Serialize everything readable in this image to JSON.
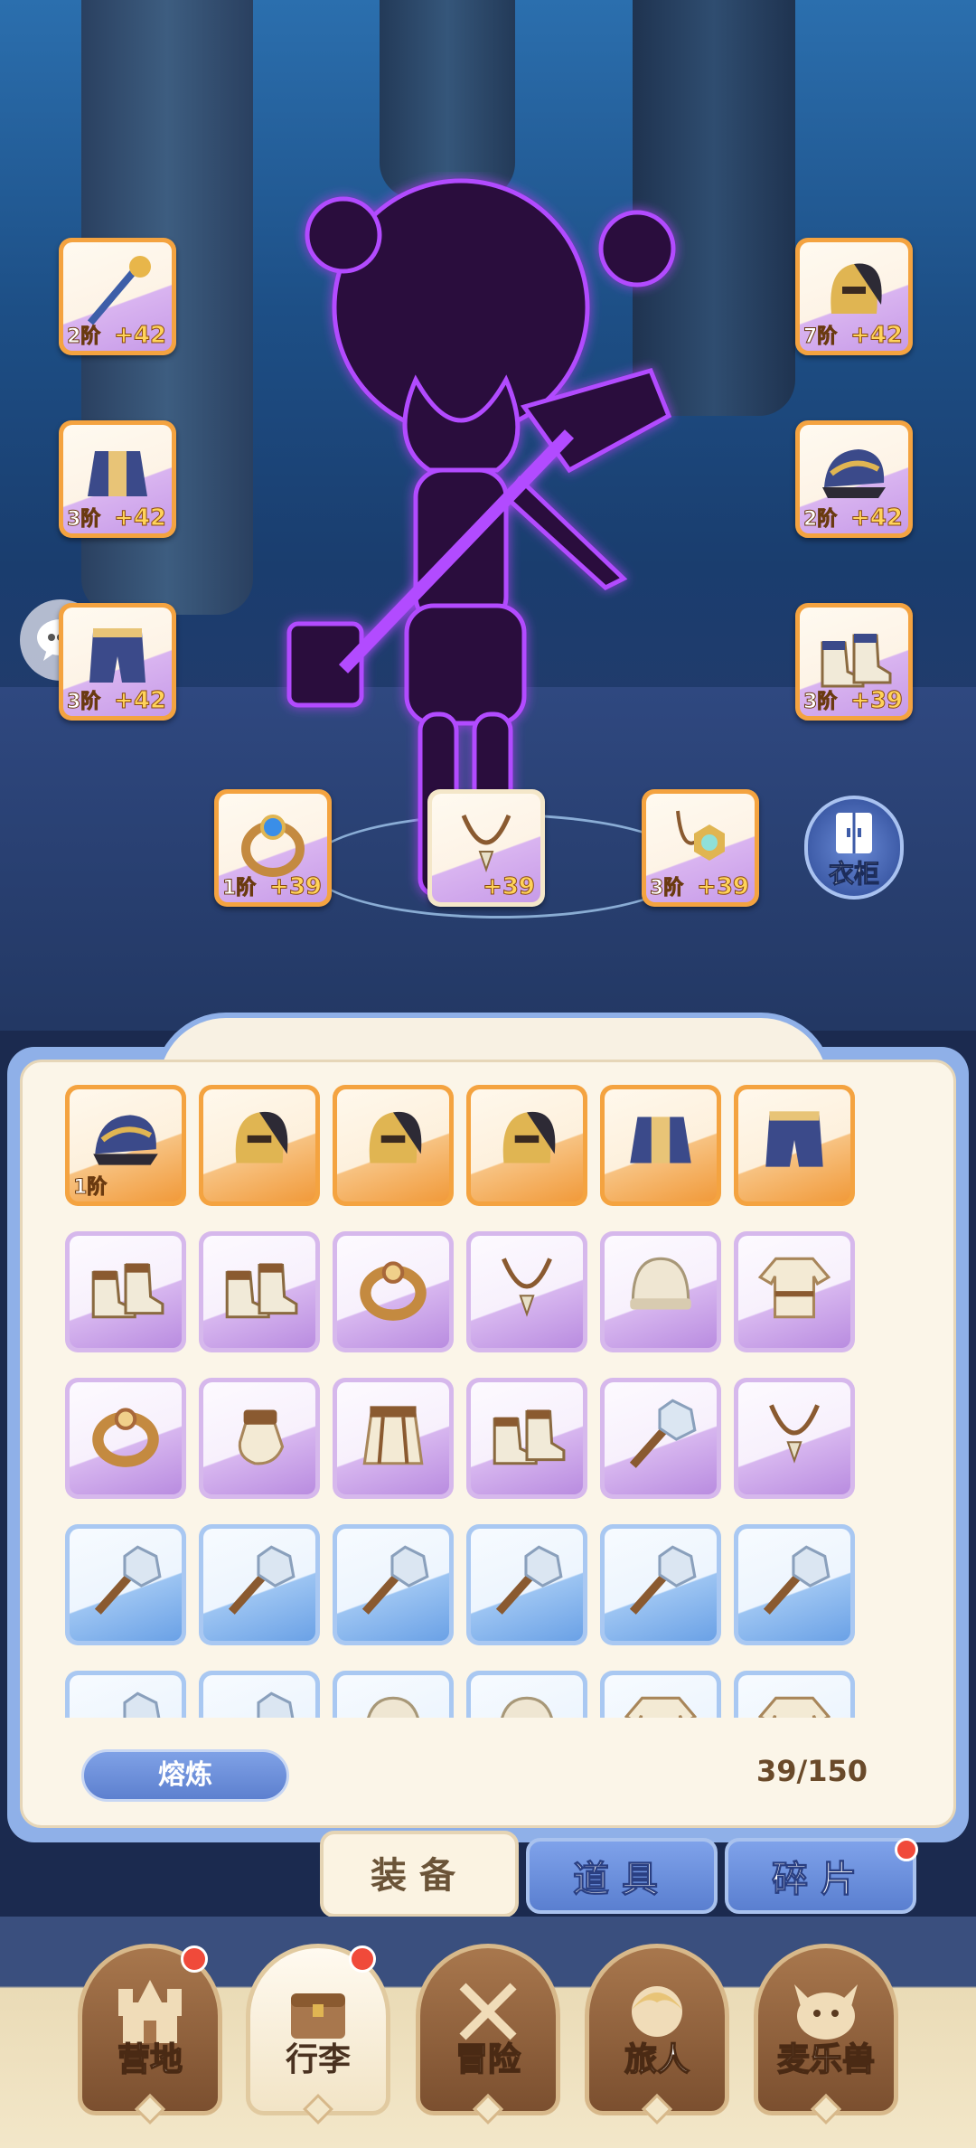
{
  "equipped_slots": [
    {
      "id": "weapon",
      "tier": "2阶",
      "bonus": "+42",
      "icon": "staff-icon"
    },
    {
      "id": "chest",
      "tier": "3阶",
      "bonus": "+42",
      "icon": "armor-icon"
    },
    {
      "id": "legs",
      "tier": "3阶",
      "bonus": "+42",
      "icon": "pants-icon"
    },
    {
      "id": "helmet-right",
      "tier": "7阶",
      "bonus": "+42",
      "icon": "helmet-icon"
    },
    {
      "id": "hat-right",
      "tier": "2阶",
      "bonus": "+42",
      "icon": "hat-icon"
    },
    {
      "id": "boots",
      "tier": "3阶",
      "bonus": "+39",
      "icon": "boots-icon"
    },
    {
      "id": "ring",
      "tier": "1阶",
      "bonus": "+39",
      "icon": "ring-icon"
    },
    {
      "id": "necklace",
      "tier": "",
      "bonus": "+39",
      "icon": "necklace-icon"
    },
    {
      "id": "amulet",
      "tier": "3阶",
      "bonus": "+39",
      "icon": "amulet-icon"
    }
  ],
  "wardrobe_label": "衣柜",
  "inventory": {
    "items": [
      {
        "rarity": "orange",
        "icon": "hat-icon",
        "tier": "1阶"
      },
      {
        "rarity": "orange",
        "icon": "helmet-icon",
        "tier": ""
      },
      {
        "rarity": "orange",
        "icon": "helmet-icon",
        "tier": ""
      },
      {
        "rarity": "orange",
        "icon": "helmet-icon",
        "tier": ""
      },
      {
        "rarity": "orange",
        "icon": "armor-icon",
        "tier": ""
      },
      {
        "rarity": "orange",
        "icon": "pants-icon",
        "tier": ""
      },
      {
        "rarity": "purple",
        "icon": "boots-icon",
        "tier": ""
      },
      {
        "rarity": "purple",
        "icon": "boots-icon",
        "tier": ""
      },
      {
        "rarity": "purple",
        "icon": "ring-icon",
        "tier": ""
      },
      {
        "rarity": "purple",
        "icon": "necklace-icon",
        "tier": ""
      },
      {
        "rarity": "purple",
        "icon": "cap-icon",
        "tier": ""
      },
      {
        "rarity": "purple",
        "icon": "shirt-icon",
        "tier": ""
      },
      {
        "rarity": "purple",
        "icon": "ring-icon",
        "tier": ""
      },
      {
        "rarity": "purple",
        "icon": "glove-icon",
        "tier": ""
      },
      {
        "rarity": "purple",
        "icon": "skirt-icon",
        "tier": ""
      },
      {
        "rarity": "purple",
        "icon": "boots-icon",
        "tier": ""
      },
      {
        "rarity": "purple",
        "icon": "mace-icon",
        "tier": ""
      },
      {
        "rarity": "purple",
        "icon": "necklace-icon",
        "tier": ""
      },
      {
        "rarity": "blue",
        "icon": "mace-icon",
        "tier": ""
      },
      {
        "rarity": "blue",
        "icon": "mace-icon",
        "tier": ""
      },
      {
        "rarity": "blue",
        "icon": "mace-icon",
        "tier": ""
      },
      {
        "rarity": "blue",
        "icon": "mace-icon",
        "tier": ""
      },
      {
        "rarity": "blue",
        "icon": "mace-icon",
        "tier": ""
      },
      {
        "rarity": "blue",
        "icon": "mace-icon",
        "tier": ""
      },
      {
        "rarity": "blue",
        "icon": "mace-icon",
        "tier": ""
      },
      {
        "rarity": "blue",
        "icon": "mace-icon",
        "tier": ""
      },
      {
        "rarity": "blue",
        "icon": "cap-icon",
        "tier": ""
      },
      {
        "rarity": "blue",
        "icon": "cap-icon",
        "tier": ""
      },
      {
        "rarity": "blue",
        "icon": "shirt-icon",
        "tier": ""
      },
      {
        "rarity": "blue",
        "icon": "shirt-icon",
        "tier": ""
      }
    ],
    "smelt_label": "熔炼",
    "capacity": "39/150"
  },
  "tabs": [
    {
      "label": "装备",
      "active": true,
      "badge": false
    },
    {
      "label": "道具",
      "active": false,
      "badge": false
    },
    {
      "label": "碎片",
      "active": false,
      "badge": true
    }
  ],
  "bottom_nav": [
    {
      "label": "营地",
      "icon": "castle-icon",
      "active": false,
      "badge": true
    },
    {
      "label": "行李",
      "icon": "chest-icon",
      "active": true,
      "badge": true
    },
    {
      "label": "冒险",
      "icon": "crossed-swords-icon",
      "active": false,
      "badge": false
    },
    {
      "label": "旅人",
      "icon": "traveler-icon",
      "active": false,
      "badge": false
    },
    {
      "label": "麦乐兽",
      "icon": "pet-icon",
      "active": false,
      "badge": false
    }
  ],
  "colors": {
    "orange_rarity": "#f4a340",
    "purple_rarity": "#b98ce0",
    "blue_rarity": "#6aa1e6",
    "badge_red": "#f04a3a",
    "character_glow": "#b24cff"
  }
}
